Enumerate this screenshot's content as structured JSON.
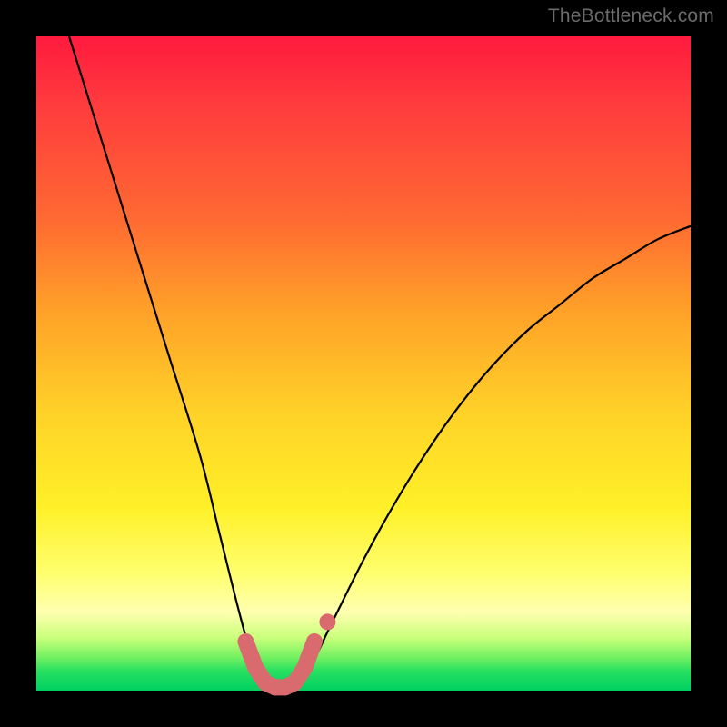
{
  "watermark": "TheBottleneck.com",
  "chart_data": {
    "type": "line",
    "title": "",
    "xlabel": "",
    "ylabel": "",
    "xlim": [
      0,
      100
    ],
    "ylim": [
      0,
      100
    ],
    "series": [
      {
        "name": "bottleneck-curve",
        "x": [
          5,
          10,
          15,
          20,
          25,
          28,
          31,
          33,
          35,
          37,
          39,
          42,
          45,
          50,
          55,
          60,
          65,
          70,
          75,
          80,
          85,
          90,
          95,
          100
        ],
        "y": [
          100,
          84,
          68,
          52,
          36,
          24,
          12,
          5,
          1,
          0,
          1,
          4,
          10,
          20,
          29,
          37,
          44,
          50,
          55,
          59,
          63,
          66,
          69,
          71
        ]
      }
    ],
    "marker_band": {
      "name": "optimal-range",
      "x": [
        32,
        33.5,
        35,
        36.5,
        38,
        39.5,
        41,
        42.5
      ],
      "y": [
        7.5,
        3.5,
        1.2,
        0.5,
        0.5,
        1.2,
        3.5,
        7.5
      ],
      "color": "#d96a6e"
    },
    "colors": {
      "curve": "#000000",
      "marker": "#d96a6e",
      "gradient_top": "#ff1a3e",
      "gradient_bottom": "#00d060"
    }
  }
}
